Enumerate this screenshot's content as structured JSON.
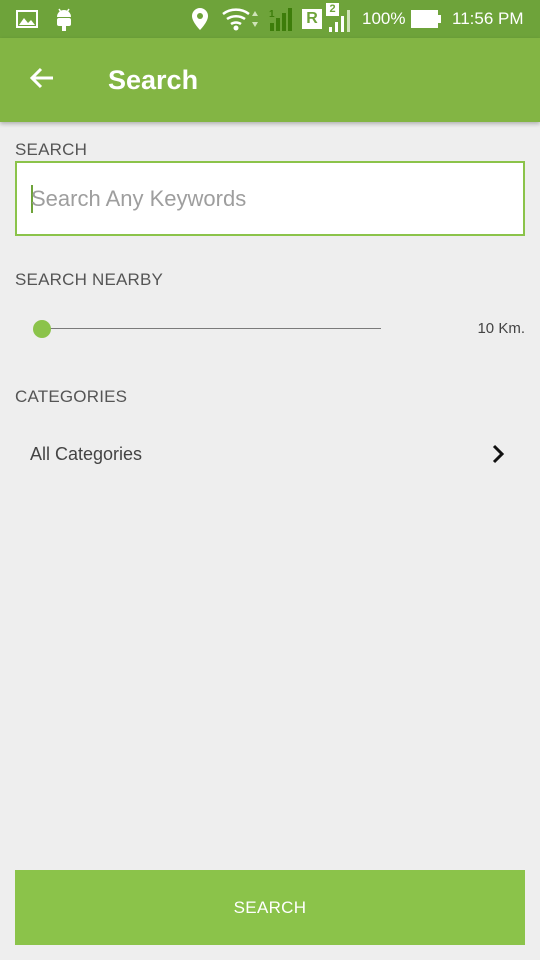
{
  "status_bar": {
    "icons": [
      "image-icon",
      "android-icon",
      "location-icon",
      "wifi-icon",
      "signal-icon",
      "roaming-icon",
      "sim2-signal-icon",
      "battery-icon"
    ],
    "roaming_label": "R",
    "sim2_label": "2",
    "battery": "100%",
    "time": "11:56 PM"
  },
  "app_bar": {
    "title": "Search",
    "color": "#83b544"
  },
  "search_section": {
    "label": "SEARCH",
    "placeholder": "Search Any Keywords",
    "value": ""
  },
  "nearby_section": {
    "label": "SEARCH NEARBY",
    "slider_fraction": 0.0,
    "value_label": "10 Km."
  },
  "categories_section": {
    "label": "CATEGORIES",
    "selected": "All Categories"
  },
  "search_button": {
    "label": "SEARCH",
    "color": "#8bc34a"
  }
}
